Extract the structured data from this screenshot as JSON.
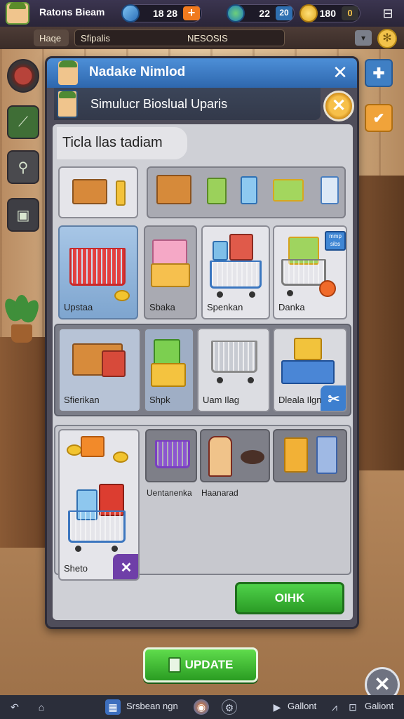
{
  "topbar": {
    "player_name": "Ratons Bieam",
    "res1_value": "18 28",
    "res1_plus": "+",
    "res2_value": "22",
    "res2_plus": "20",
    "res3_value": "180",
    "res3_plus": "0",
    "minimize": "⊟"
  },
  "subbar": {
    "tab1": "Haqe",
    "tab2_left": "Sfipalis",
    "tab2_center": "NESOSIS",
    "dropdown": "▾",
    "settings": "✻"
  },
  "panel": {
    "title": "Nadake Nimlod",
    "close": "✕",
    "subtitle": "Simulucr Bioslual Uparis",
    "cancel": "✕",
    "section_title": "Ticla llas tadiam",
    "row1_labels": [
      "Upstaa",
      "Sbaka",
      "Spenkan",
      "Danka"
    ],
    "row1_badge": "mmp\nsibs",
    "row2_labels": [
      "Sfierikan",
      "Shpk",
      "Uam Ilag",
      "Dleala Ilgn"
    ],
    "row2_badge": "✂",
    "row3_labels": [
      "Sheto",
      "Uentanenka",
      "Haanarad"
    ],
    "row3_badge": "✕",
    "ok_button": "OIHK"
  },
  "update_button": "UPDATE",
  "close_round": "✕",
  "bottombar": {
    "label1": "Srsbean ngn",
    "label2": "Gallont",
    "label3": "Galiont"
  },
  "colors": {
    "header_blue": "#2e67ad",
    "green_button": "#2a9b25",
    "accent_orange": "#f07a1e",
    "coin_gold": "#f2c42f"
  }
}
